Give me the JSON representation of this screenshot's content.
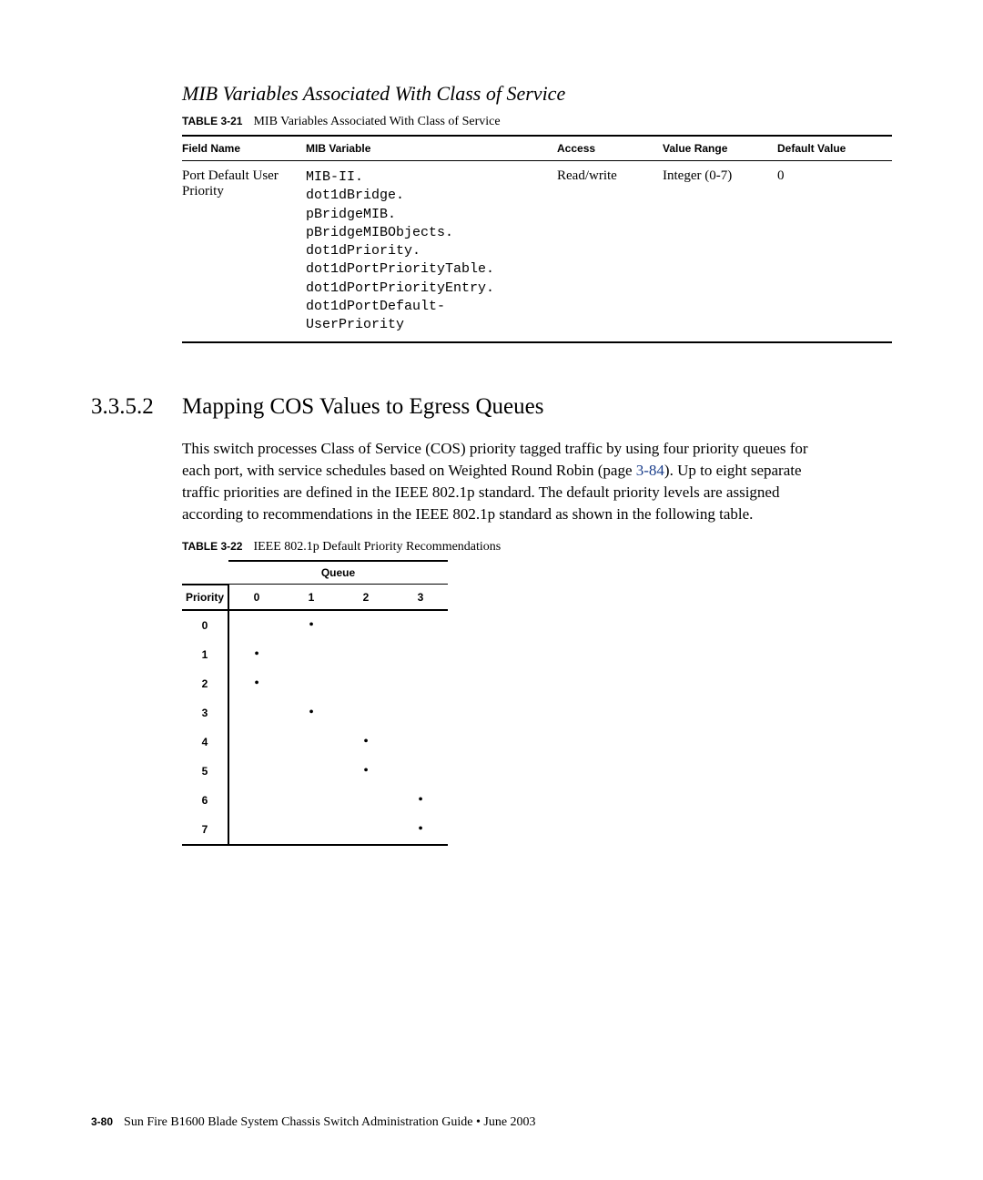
{
  "section_title": "MIB Variables Associated With Class of Service",
  "table21": {
    "label": "TABLE 3-21",
    "caption": "MIB Variables Associated With Class of Service",
    "headers": {
      "field_name": "Field Name",
      "mib_variable": "MIB Variable",
      "access": "Access",
      "value_range": "Value Range",
      "default_value": "Default Value"
    },
    "row": {
      "field_name": "Port Default User Priority",
      "mib_variable": "MIB-II.\ndot1dBridge.\npBridgeMIB.\npBridgeMIBObjects.\ndot1dPriority.\ndot1dPortPriorityTable.\ndot1dPortPriorityEntry.\ndot1dPortDefault-\nUserPriority",
      "access": "Read/write",
      "value_range": "Integer (0-7)",
      "default_value": "0"
    }
  },
  "heading": {
    "number": "3.3.5.2",
    "text": "Mapping COS Values to Egress Queues"
  },
  "paragraph": {
    "t1": "This switch processes Class of Service (COS) priority tagged traffic by using four priority queues for each port, with service schedules based on Weighted Round Robin (page ",
    "link": "3-84",
    "t2": "). Up to eight separate traffic priorities are defined in the IEEE 802.1p standard. The default priority levels are assigned according to recommendations in the IEEE 802.1p standard as shown in the following table."
  },
  "table22": {
    "label": "TABLE 3-22",
    "caption": "IEEE 802.1p Default Priority Recommendations",
    "queue_label": "Queue",
    "priority_label": "Priority",
    "cols": [
      "0",
      "1",
      "2",
      "3"
    ],
    "rows": [
      "0",
      "1",
      "2",
      "3",
      "4",
      "5",
      "6",
      "7"
    ]
  },
  "chart_data": {
    "type": "table",
    "title": "IEEE 802.1p Default Priority Recommendations",
    "x": "Priority",
    "y": "Queue",
    "mapping": {
      "0": 1,
      "1": 0,
      "2": 0,
      "3": 1,
      "4": 2,
      "5": 2,
      "6": 3,
      "7": 3
    }
  },
  "footer": {
    "page": "3-80",
    "text": "Sun Fire B1600 Blade System Chassis Switch Administration Guide • June 2003"
  }
}
